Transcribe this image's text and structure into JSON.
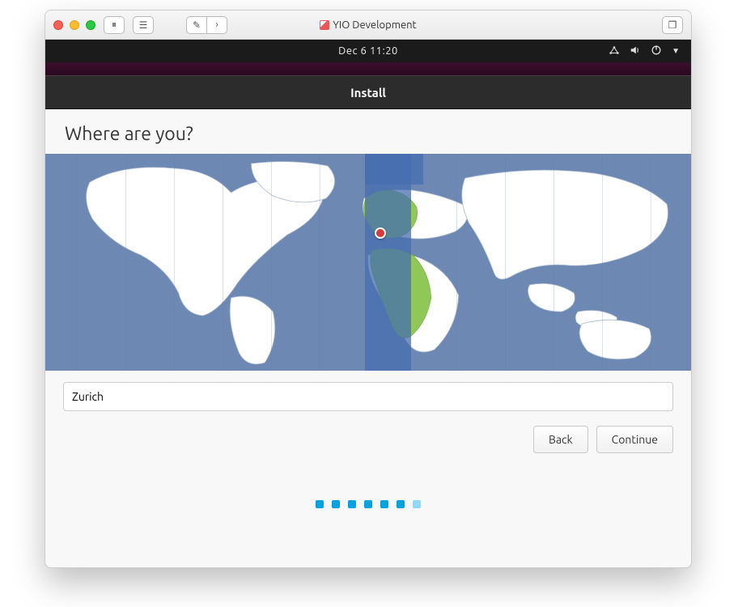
{
  "mac": {
    "title": "YIO Development"
  },
  "ubuntu": {
    "datetime": "Dec 6  11:20",
    "window_title": "Install"
  },
  "page": {
    "heading": "Where are you?",
    "timezone_value": "Zurich"
  },
  "buttons": {
    "back": "Back",
    "continue": "Continue"
  },
  "progress": {
    "total": 7,
    "current": 6
  }
}
